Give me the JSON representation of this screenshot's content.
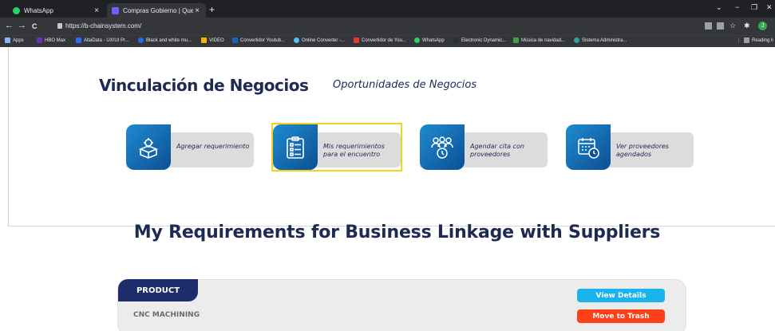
{
  "browser": {
    "tabs": [
      {
        "title": "WhatsApp",
        "icon": "whatsapp-icon",
        "color": "#25d366",
        "close": "×"
      },
      {
        "title": "Compras Gobierno | Querétaro",
        "icon": "site-icon",
        "color": "#6c63ff",
        "close": "×"
      }
    ],
    "new_tab": "+",
    "window_controls": {
      "minimize": "−",
      "restore": "❐",
      "close": "✕"
    },
    "nav": {
      "back": "←",
      "forward": "→",
      "reload": "C"
    },
    "url": "https://b-chainsystem.com/",
    "profile_initial": "J",
    "bookmarks": [
      {
        "label": "Apps",
        "color": "#8ab4f8"
      },
      {
        "label": "HBO Max",
        "color": "#6b2fbf"
      },
      {
        "label": "AltaData - UX/UI Pr...",
        "color": "#2b6cf0"
      },
      {
        "label": "Black and white mu...",
        "color": "#1a73e8"
      },
      {
        "label": "VIDEO",
        "color": "#f4b400"
      },
      {
        "label": "Convertidor Youtub...",
        "color": "#1565c0"
      },
      {
        "label": "Online Converter -...",
        "color": "#4fc3f7"
      },
      {
        "label": "Convertidor de You...",
        "color": "#e53935"
      },
      {
        "label": "WhatsApp",
        "color": "#25d366"
      },
      {
        "label": "Electronic Dynamic...",
        "color": "#263238"
      },
      {
        "label": "Música de navidad...",
        "color": "#43a047"
      },
      {
        "label": "Sistema Administra...",
        "color": "#26a69a"
      }
    ],
    "reading_list": "Reading li"
  },
  "header": {
    "title": "Vinculación de Negocios",
    "subtitle": "Oportunidades de Negocios"
  },
  "cards": [
    {
      "label": "Agregar requerimiento",
      "icon": "box-gear-icon",
      "selected": false
    },
    {
      "label": "Mis requerimientos para el encuentro",
      "icon": "clipboard-list-icon",
      "selected": true
    },
    {
      "label": "Agendar cita con proveedores",
      "icon": "people-clock-icon",
      "selected": false
    },
    {
      "label": "Ver proveedores agendados",
      "icon": "calendar-clock-icon",
      "selected": false
    }
  ],
  "requirements": {
    "title": "My Requirements for Business Linkage with Suppliers",
    "column_header": "PRODUCT",
    "rows": [
      {
        "product": "CNC MACHINING",
        "view_label": "View Details",
        "trash_label": "Move to Trash"
      }
    ]
  }
}
